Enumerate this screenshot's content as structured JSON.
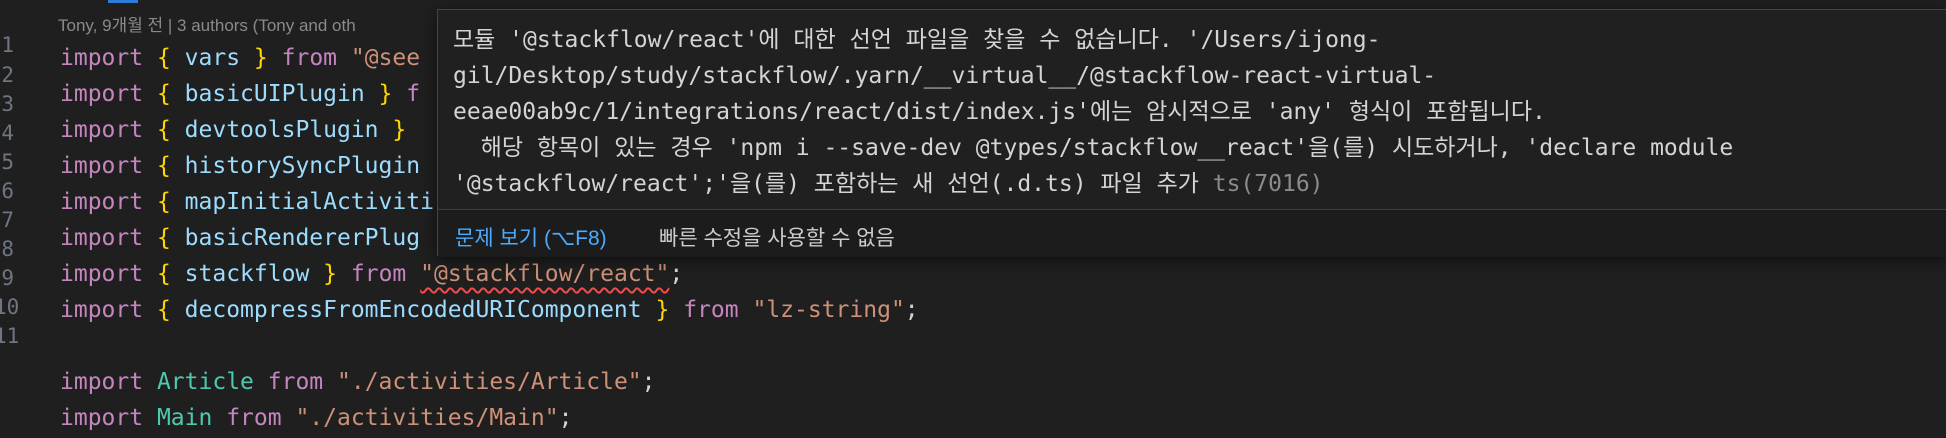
{
  "editor": {
    "blame": "Tony, 9개월 전 | 3 authors (Tony and oth",
    "line_numbers": [
      "1",
      "2",
      "3",
      "4",
      "5",
      "6",
      "7",
      "8",
      "9",
      "10",
      "11"
    ],
    "lines": [
      {
        "kw": "import",
        "open": "{",
        "name": "vars",
        "close": "}",
        "from": "from",
        "src": "\"@see"
      },
      {
        "kw": "import",
        "open": "{",
        "name": "basicUIPlugin",
        "close": "}",
        "from": "f"
      },
      {
        "kw": "import",
        "open": "{",
        "name": "devtoolsPlugin",
        "close": "}"
      },
      {
        "kw": "import",
        "open": "{",
        "name": "historySyncPlugin"
      },
      {
        "kw": "import",
        "open": "{",
        "name": "mapInitialActiviti"
      },
      {
        "kw": "import",
        "open": "{",
        "name": "basicRendererPlug"
      },
      {
        "kw": "import",
        "open": "{",
        "name": "stackflow",
        "close": "}",
        "from": "from",
        "src": "\"@stackflow/react\"",
        "semi": ";"
      },
      {
        "kw": "import",
        "open": "{",
        "name": "decompressFromEncodedURIComponent",
        "close": "}",
        "from": "from",
        "src": "\"lz-string\"",
        "semi": ";"
      },
      {},
      {
        "kw": "import",
        "name": "Article",
        "from": "from",
        "src": "\"./activities/Article\"",
        "semi": ";"
      },
      {
        "kw": "import",
        "name": "Main",
        "from": "from",
        "src": "\"./activities/Main\"",
        "semi": ";"
      }
    ]
  },
  "hover": {
    "message_lines": [
      "모듈 '@stackflow/react'에 대한 선언 파일을 찾을 수 없습니다. '/Users/ijong-",
      "gil/Desktop/study/stackflow/.yarn/__virtual__/@stackflow-react-virtual-",
      "eeae00ab9c/1/integrations/react/dist/index.js'에는 암시적으로 'any' 형식이 포함됩니다.",
      "  해당 항목이 있는 경우 'npm i --save-dev @types/stackflow__react'을(를) 시도하거나, 'declare module",
      "'@stackflow/react';'을(를) 포함하는 새 선언(.d.ts) 파일 추가 "
    ],
    "error_code": "ts(7016)",
    "peek_problem": "문제 보기 (⌥F8)",
    "no_quick_fix": "빠른 수정을 사용할 수 없음"
  },
  "colors": {
    "background": "#1f1f1f",
    "keyword": "#c586c0",
    "identifier": "#9cdcfe",
    "class": "#4ec9b0",
    "string": "#ce9178",
    "brace": "#ffd700",
    "link": "#4daafc",
    "error_squiggle": "#f14c4c"
  }
}
